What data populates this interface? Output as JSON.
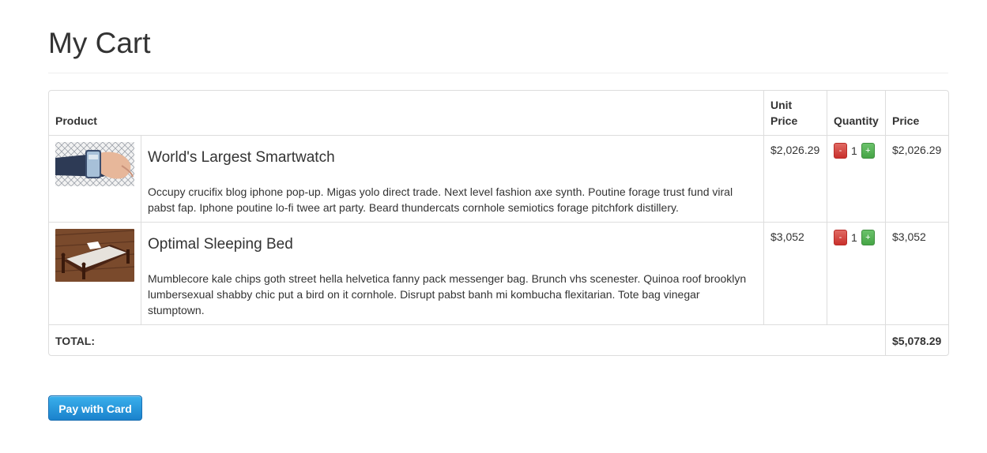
{
  "page_title": "My Cart",
  "table": {
    "headers": {
      "product": "Product",
      "unit_price": "Unit Price",
      "quantity": "Quantity",
      "price": "Price"
    },
    "items": [
      {
        "name": "World's Largest Smartwatch",
        "description": "Occupy crucifix blog iphone pop-up. Migas yolo direct trade. Next level fashion axe synth. Poutine forage trust fund viral pabst fap. Iphone poutine lo-fi twee art party. Beard thundercats cornhole semiotics forage pitchfork distillery.",
        "unit_price": "$2,026.29",
        "quantity": "1",
        "price": "$2,026.29",
        "image": "smartwatch-photo"
      },
      {
        "name": "Optimal Sleeping Bed",
        "description": "Mumblecore kale chips goth street hella helvetica fanny pack messenger bag. Brunch vhs scenester. Quinoa roof brooklyn lumbersexual shabby chic put a bird on it cornhole. Disrupt pabst banh mi kombucha flexitarian. Tote bag vinegar stumptown.",
        "unit_price": "$3,052",
        "quantity": "1",
        "price": "$3,052",
        "image": "bed-photo"
      }
    ],
    "decrement_label": "-",
    "increment_label": "+",
    "total_label": "TOTAL:",
    "total_value": "$5,078.29"
  },
  "pay_button_label": "Pay with Card",
  "colors": {
    "decrement": "#d9534f",
    "increment": "#5cb85c",
    "pay_button": "#1f8dd6"
  }
}
